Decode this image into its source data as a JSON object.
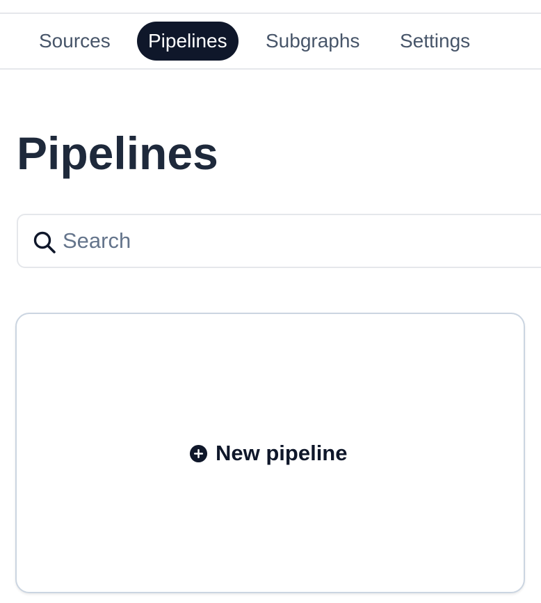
{
  "nav": {
    "tabs": [
      {
        "label": "Sources",
        "active": false
      },
      {
        "label": "Pipelines",
        "active": true
      },
      {
        "label": "Subgraphs",
        "active": false
      },
      {
        "label": "Settings",
        "active": false
      }
    ]
  },
  "main": {
    "title": "Pipelines",
    "search": {
      "placeholder": "Search",
      "value": "",
      "icon": "search-icon"
    },
    "new_pipeline": {
      "label": "New pipeline",
      "icon": "plus-circle-icon"
    }
  },
  "colors": {
    "active_tab_bg": "#0f172a",
    "text_primary": "#1e293b",
    "text_muted": "#475569",
    "border": "#e5e7eb"
  }
}
